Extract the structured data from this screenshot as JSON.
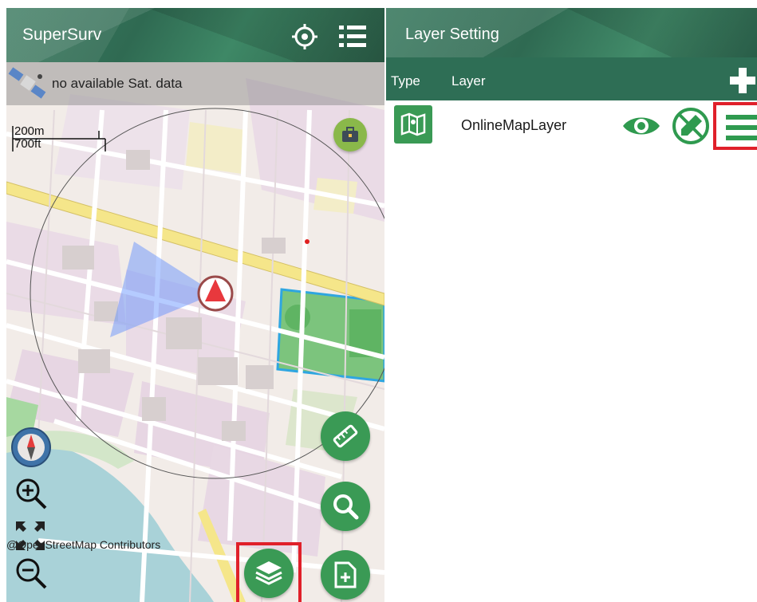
{
  "left_panel": {
    "app_title": "SuperSurv",
    "header_icons": [
      "locate-crosshair-icon",
      "menu-list-icon"
    ],
    "sat_status": "no available Sat. data",
    "scale_metric": "200m",
    "scale_imperial": "700ft",
    "map_credit": "@OpenStreetMap Contributors",
    "map_controls": [
      "compass-icon",
      "zoom-in-icon",
      "fullscreen-icon",
      "zoom-out-icon"
    ],
    "fab_buttons": [
      "ruler-icon",
      "search-icon",
      "layers-icon",
      "add-document-icon",
      "toolbox-icon"
    ]
  },
  "right_panel": {
    "title": "Layer Setting",
    "columns": {
      "type": "Type",
      "layer": "Layer"
    },
    "layers": [
      {
        "name": "OnlineMapLayer",
        "type_icon": "map-layer-icon",
        "actions": [
          "visibility-eye-icon",
          "edit-disabled-icon",
          "layer-menu-icon"
        ]
      }
    ]
  },
  "colors": {
    "header_green": "#2f6a52",
    "column_header": "#2e6e55",
    "fab_green": "#3a9a55",
    "highlight_red": "#e0202a",
    "marker_red": "#e8383d"
  }
}
